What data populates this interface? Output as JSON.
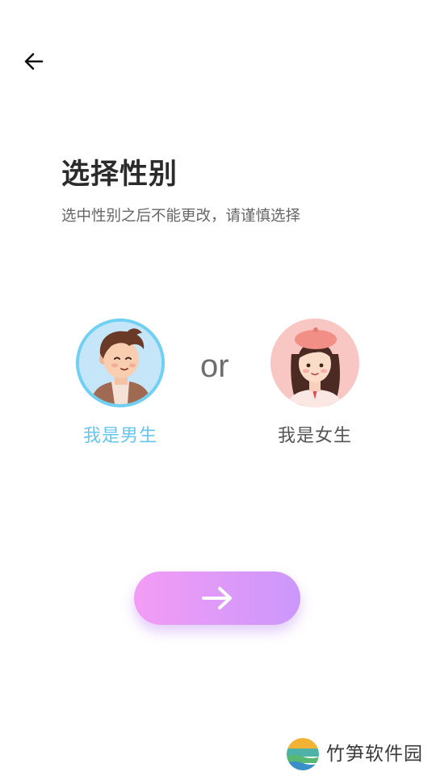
{
  "header": {
    "back_icon": "arrow-left-icon"
  },
  "intro": {
    "title": "选择性别",
    "subtitle": "选中性别之后不能更改，请谨慎选择"
  },
  "gender_options": [
    {
      "label": "我是男生",
      "icon": "male-avatar",
      "selected": true,
      "accent": "#66c6ef"
    },
    {
      "label": "我是女生",
      "icon": "female-avatar",
      "selected": false
    }
  ],
  "divider_text": "or",
  "next_button": {
    "icon": "arrow-right-icon",
    "gradient": [
      "#f39cf5",
      "#cb97fb"
    ]
  },
  "watermark": {
    "text": "竹笋软件园"
  }
}
